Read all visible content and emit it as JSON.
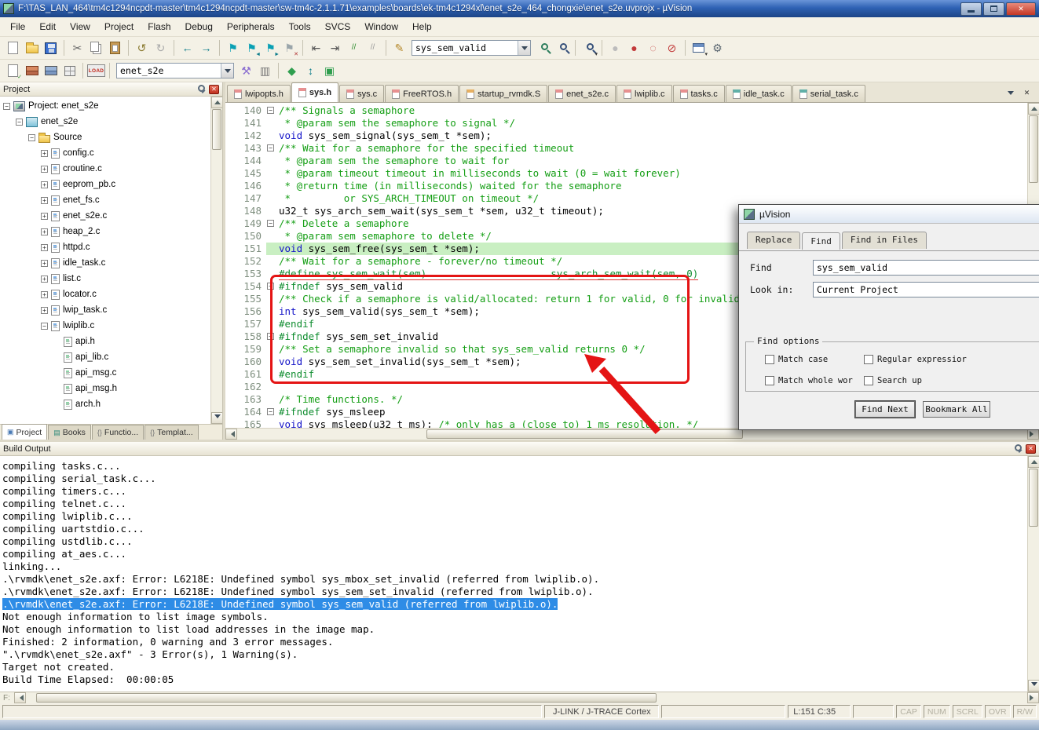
{
  "window": {
    "title": "F:\\TAS_LAN_464\\tm4c1294ncpdt-master\\tm4c1294ncpdt-master\\sw-tm4c-2.1.1.71\\examples\\boards\\ek-tm4c1294xl\\enet_s2e_464_chongxie\\enet_s2e.uvprojx - µVision"
  },
  "icons": {
    "close": "✕"
  },
  "menu": {
    "items": [
      "File",
      "Edit",
      "View",
      "Project",
      "Flash",
      "Debug",
      "Peripherals",
      "Tools",
      "SVCS",
      "Window",
      "Help"
    ]
  },
  "toolbar1": [
    {
      "t": "ico",
      "name": "new-file-icon",
      "k": "page"
    },
    {
      "t": "ico",
      "name": "open-file-icon",
      "k": "folder"
    },
    {
      "t": "ico",
      "name": "save-icon",
      "k": "floppy"
    },
    {
      "t": "sep"
    },
    {
      "t": "ico",
      "name": "cut-icon",
      "g": "✂",
      "c": "#666666"
    },
    {
      "t": "ico",
      "name": "copy-icon",
      "k": "copy"
    },
    {
      "t": "ico",
      "name": "paste-icon",
      "k": "paste"
    },
    {
      "t": "sep"
    },
    {
      "t": "ico",
      "name": "undo-icon",
      "g": "↺",
      "c": "#8a7a30"
    },
    {
      "t": "ico",
      "name": "redo-icon",
      "g": "↻",
      "c": "#aaaaaa"
    },
    {
      "t": "sep"
    },
    {
      "t": "ico",
      "name": "nav-back-icon",
      "g": "←",
      "c": "#0b7b8a"
    },
    {
      "t": "ico",
      "name": "nav-forward-icon",
      "g": "→",
      "c": "#0b7b8a"
    },
    {
      "t": "sep"
    },
    {
      "t": "ico",
      "name": "toggle-bookmark-icon",
      "g": "⚑",
      "c": "#0aa0b4"
    },
    {
      "t": "ico",
      "name": "prev-bookmark-icon",
      "g": "⚑",
      "c": "#0aa0b4",
      "sub": "◄",
      "subc": "#0b7b8a"
    },
    {
      "t": "ico",
      "name": "next-bookmark-icon",
      "g": "⚑",
      "c": "#0aa0b4",
      "sub": "►",
      "subc": "#0b7b8a"
    },
    {
      "t": "ico",
      "name": "clear-bookmarks-icon",
      "g": "⚑",
      "c": "#9aa5aa",
      "sub": "✕",
      "subc": "#b03030"
    },
    {
      "t": "sep"
    },
    {
      "t": "ico",
      "name": "unindent-icon",
      "g": "⇤",
      "c": "#555555"
    },
    {
      "t": "ico",
      "name": "indent-icon",
      "g": "⇥",
      "c": "#555555"
    },
    {
      "t": "ico",
      "name": "comment-icon",
      "g": "//",
      "c": "#2a8a2a"
    },
    {
      "t": "ico",
      "name": "uncomment-icon",
      "g": "//",
      "c": "#999999"
    },
    {
      "t": "sep"
    },
    {
      "t": "ico",
      "name": "edit-marker-icon",
      "g": "✎",
      "c": "#b5882a"
    },
    {
      "t": "combo",
      "name": "find-text-combo",
      "value": "sys_sem_valid",
      "w": 152
    },
    {
      "t": "ico",
      "name": "find-in-files-icon",
      "k": "mag2"
    },
    {
      "t": "ico",
      "name": "find-icon",
      "k": "mag"
    },
    {
      "t": "sep"
    },
    {
      "t": "ico",
      "name": "search-scope-icon",
      "k": "mag",
      "sub": "▾",
      "subc": "#333333"
    },
    {
      "t": "sep"
    },
    {
      "t": "ico",
      "name": "debug-session-icon",
      "g": "●",
      "c": "#bcbcbc"
    },
    {
      "t": "ico",
      "name": "breakpoint-icon",
      "g": "●",
      "c": "#c23a3a"
    },
    {
      "t": "ico",
      "name": "disable-breakpoints-icon",
      "g": "◌",
      "c": "#c23a3a"
    },
    {
      "t": "ico",
      "name": "kill-breakpoints-icon",
      "g": "⊘",
      "c": "#c23a3a"
    },
    {
      "t": "sep"
    },
    {
      "t": "ico",
      "name": "debug-windows-icon",
      "k": "winico",
      "sub": "▾",
      "subc": "#333333"
    },
    {
      "t": "ico",
      "name": "configure-wrench-icon",
      "g": "⚙",
      "c": "#5a6670"
    }
  ],
  "toolbar2": [
    {
      "t": "ico",
      "name": "translate-icon",
      "k": "page",
      "sub": "✓",
      "subc": "#2a8a2a"
    },
    {
      "t": "ico",
      "name": "build-icon",
      "k": "bricks"
    },
    {
      "t": "ico",
      "name": "rebuild-icon",
      "k": "bricks2"
    },
    {
      "t": "ico",
      "name": "batch-build-icon",
      "k": "grid"
    },
    {
      "t": "sep"
    },
    {
      "t": "ico",
      "name": "flash-download-icon",
      "k": "load",
      "label": "LOAD"
    },
    {
      "t": "sep"
    },
    {
      "t": "combo",
      "name": "target-select-combo",
      "value": "enet_s2e",
      "w": 150
    },
    {
      "t": "ico",
      "name": "options-for-target-icon",
      "g": "⚒",
      "c": "#8a6dd0"
    },
    {
      "t": "ico",
      "name": "file-extensions-icon",
      "g": "▥",
      "c": "#777777"
    },
    {
      "t": "sep"
    },
    {
      "t": "ico",
      "name": "manage-rte-icon",
      "g": "◆",
      "c": "#2f9e4e"
    },
    {
      "t": "ico",
      "name": "select-packs-icon",
      "g": "↕",
      "c": "#0b7b8a"
    },
    {
      "t": "ico",
      "name": "pack-installer-icon",
      "g": "▣",
      "c": "#2f9e4e"
    }
  ],
  "project_panel": {
    "title": "Project",
    "tree": [
      {
        "depth": 0,
        "exp": "-",
        "icon": "project",
        "label": "Project: enet_s2e"
      },
      {
        "depth": 1,
        "exp": "-",
        "icon": "target",
        "label": "enet_s2e"
      },
      {
        "depth": 2,
        "exp": "-",
        "icon": "folder",
        "label": "Source"
      },
      {
        "depth": 3,
        "exp": "+",
        "icon": "file",
        "label": "config.c"
      },
      {
        "depth": 3,
        "exp": "+",
        "icon": "file",
        "label": "croutine.c"
      },
      {
        "depth": 3,
        "exp": "+",
        "icon": "file",
        "label": "eeprom_pb.c"
      },
      {
        "depth": 3,
        "exp": "+",
        "icon": "file",
        "label": "enet_fs.c"
      },
      {
        "depth": 3,
        "exp": "+",
        "icon": "file",
        "label": "enet_s2e.c"
      },
      {
        "depth": 3,
        "exp": "+",
        "icon": "file",
        "label": "heap_2.c"
      },
      {
        "depth": 3,
        "exp": "+",
        "icon": "file",
        "label": "httpd.c"
      },
      {
        "depth": 3,
        "exp": "+",
        "icon": "file",
        "label": "idle_task.c"
      },
      {
        "depth": 3,
        "exp": "+",
        "icon": "file",
        "label": "list.c"
      },
      {
        "depth": 3,
        "exp": "+",
        "icon": "file",
        "label": "locator.c"
      },
      {
        "depth": 3,
        "exp": "+",
        "icon": "file",
        "label": "lwip_task.c"
      },
      {
        "depth": 3,
        "exp": "-",
        "icon": "file",
        "label": "lwiplib.c"
      },
      {
        "depth": 4,
        "exp": "",
        "icon": "file2",
        "label": "api.h"
      },
      {
        "depth": 4,
        "exp": "",
        "icon": "file2",
        "label": "api_lib.c"
      },
      {
        "depth": 4,
        "exp": "",
        "icon": "file2",
        "label": "api_msg.c"
      },
      {
        "depth": 4,
        "exp": "",
        "icon": "file2",
        "label": "api_msg.h"
      },
      {
        "depth": 4,
        "exp": "",
        "icon": "file2",
        "label": "arch.h"
      }
    ],
    "bottom_tabs": [
      {
        "label": "Project",
        "glyph": "▣",
        "color": "#4a7ab5",
        "active": true
      },
      {
        "label": "Books",
        "glyph": "▤",
        "color": "#2f8a7a",
        "active": false
      },
      {
        "label": "Functio...",
        "glyph": "{}",
        "color": "#777777",
        "active": false
      },
      {
        "label": "Templat...",
        "glyph": "{}",
        "color": "#777777",
        "active": false
      }
    ]
  },
  "editor": {
    "active_tab_index": 1,
    "tabs": [
      {
        "label": "lwipopts.h",
        "color": "#e89090"
      },
      {
        "label": "sys.h",
        "color": "#e89090"
      },
      {
        "label": "sys.c",
        "color": "#e89090"
      },
      {
        "label": "FreeRTOS.h",
        "color": "#e89090"
      },
      {
        "label": "startup_rvmdk.S",
        "color": "#e8b060"
      },
      {
        "label": "enet_s2e.c",
        "color": "#e89090"
      },
      {
        "label": "lwiplib.c",
        "color": "#e89090"
      },
      {
        "label": "tasks.c",
        "color": "#e89090"
      },
      {
        "label": "idle_task.c",
        "color": "#60b0a8"
      },
      {
        "label": "serial_task.c",
        "color": "#60b0a8"
      }
    ],
    "lines": [
      {
        "n": "140",
        "fold": "-",
        "seg": [
          [
            "c",
            "/** Signals a semaphore"
          ]
        ]
      },
      {
        "n": "141",
        "seg": [
          [
            "c",
            " * @param sem the semaphore to signal */"
          ]
        ]
      },
      {
        "n": "142",
        "seg": [
          [
            "k",
            "void"
          ],
          [
            "t",
            " sys_sem_signal(sys_sem_t *sem);"
          ]
        ]
      },
      {
        "n": "143",
        "fold": "-",
        "seg": [
          [
            "c",
            "/** Wait for a semaphore for the specified timeout"
          ]
        ]
      },
      {
        "n": "144",
        "seg": [
          [
            "c",
            " * @param sem the semaphore to wait for"
          ]
        ]
      },
      {
        "n": "145",
        "seg": [
          [
            "c",
            " * @param timeout timeout in milliseconds to wait (0 = wait forever)"
          ]
        ]
      },
      {
        "n": "146",
        "seg": [
          [
            "c",
            " * @return time (in milliseconds) waited for the semaphore"
          ]
        ]
      },
      {
        "n": "147",
        "seg": [
          [
            "c",
            " *         or SYS_ARCH_TIMEOUT on timeout */"
          ]
        ]
      },
      {
        "n": "148",
        "seg": [
          [
            "t",
            "u32_t sys_arch_sem_wait(sys_sem_t *sem, u32_t timeout);"
          ]
        ]
      },
      {
        "n": "149",
        "fold": "-",
        "seg": [
          [
            "c",
            "/** Delete a semaphore"
          ]
        ]
      },
      {
        "n": "150",
        "seg": [
          [
            "c",
            " * @param sem semaphore to delete */"
          ]
        ]
      },
      {
        "n": "151",
        "hl": true,
        "seg": [
          [
            "k",
            "void"
          ],
          [
            "t",
            " sys_sem_free(sys_sem_t *sem);"
          ]
        ]
      },
      {
        "n": "152",
        "seg": [
          [
            "c",
            "/** Wait for a semaphore - forever/no timeout */"
          ]
        ]
      },
      {
        "n": "153",
        "err": true,
        "seg": [
          [
            "p",
            "#define sys_sem_wait(sem)"
          ],
          [
            "p",
            "                     sys_arch_sem_wait(sem, 0)"
          ]
        ]
      },
      {
        "n": "154",
        "fold": "-",
        "seg": [
          [
            "p",
            "#ifndef"
          ],
          [
            "t",
            " sys_sem_valid"
          ]
        ]
      },
      {
        "n": "155",
        "seg": [
          [
            "c",
            "/** Check if a semaphore is valid/allocated: return 1 for valid, 0 for invalid */"
          ]
        ]
      },
      {
        "n": "156",
        "seg": [
          [
            "k",
            "int"
          ],
          [
            "t",
            " sys_sem_valid(sys_sem_t *sem);"
          ]
        ]
      },
      {
        "n": "157",
        "seg": [
          [
            "p",
            "#endif"
          ]
        ]
      },
      {
        "n": "158",
        "fold": "-",
        "seg": [
          [
            "p",
            "#ifndef"
          ],
          [
            "t",
            " sys_sem_set_invalid"
          ]
        ]
      },
      {
        "n": "159",
        "seg": [
          [
            "c",
            "/** Set a semaphore invalid so that sys_sem_valid returns 0 */"
          ]
        ]
      },
      {
        "n": "160",
        "seg": [
          [
            "k",
            "void"
          ],
          [
            "t",
            " sys_sem_set_invalid(sys_sem_t *sem);"
          ]
        ]
      },
      {
        "n": "161",
        "seg": [
          [
            "p",
            "#endif"
          ]
        ]
      },
      {
        "n": "162",
        "seg": [
          [
            "t",
            ""
          ]
        ]
      },
      {
        "n": "163",
        "seg": [
          [
            "c",
            "/* Time functions. */"
          ]
        ]
      },
      {
        "n": "164",
        "fold": "-",
        "seg": [
          [
            "p",
            "#ifndef"
          ],
          [
            "t",
            " sys_msleep"
          ]
        ]
      },
      {
        "n": "165",
        "seg": [
          [
            "k",
            "void"
          ],
          [
            "t",
            " sys_msleep(u32_t ms); "
          ],
          [
            "c",
            "/* only has a (close to) 1 ms resolution. */"
          ]
        ]
      }
    ]
  },
  "find_dialog": {
    "title": "µVision",
    "tabs": [
      "Replace",
      "Find",
      "Find in Files"
    ],
    "active_tab": "Find",
    "find_label": "Find",
    "find_value": "sys_sem_valid",
    "look_in_label": "Look in:",
    "look_in_value": "Current Project",
    "options_title": "Find options",
    "options": [
      "Match case",
      "Regular expressior",
      "Match whole wor",
      "Search up"
    ],
    "buttons": [
      "Find Next",
      "Bookmark All"
    ]
  },
  "build_output": {
    "title": "Build Output",
    "highlight_index": 11,
    "lines": [
      "compiling tasks.c...",
      "compiling serial_task.c...",
      "compiling timers.c...",
      "compiling telnet.c...",
      "compiling lwiplib.c...",
      "compiling uartstdio.c...",
      "compiling ustdlib.c...",
      "compiling at_aes.c...",
      "linking...",
      ".\\rvmdk\\enet_s2e.axf: Error: L6218E: Undefined symbol sys_mbox_set_invalid (referred from lwiplib.o).",
      ".\\rvmdk\\enet_s2e.axf: Error: L6218E: Undefined symbol sys_sem_set_invalid (referred from lwiplib.o).",
      ".\\rvmdk\\enet_s2e.axf: Error: L6218E: Undefined symbol sys_sem_valid (referred from lwiplib.o).",
      "Not enough information to list image symbols.",
      "Not enough information to list load addresses in the image map.",
      "Finished: 2 information, 0 warning and 3 error messages.",
      "\".\\rvmdk\\enet_s2e.axf\" - 3 Error(s), 1 Warning(s).",
      "Target not created.",
      "Build Time Elapsed:  00:00:05"
    ]
  },
  "status_bar": {
    "hint": "F:",
    "debugger": "J-LINK / J-TRACE Cortex",
    "position": "L:151 C:35",
    "flags": [
      "CAP",
      "NUM",
      "SCRL",
      "OVR",
      "R/W"
    ]
  }
}
